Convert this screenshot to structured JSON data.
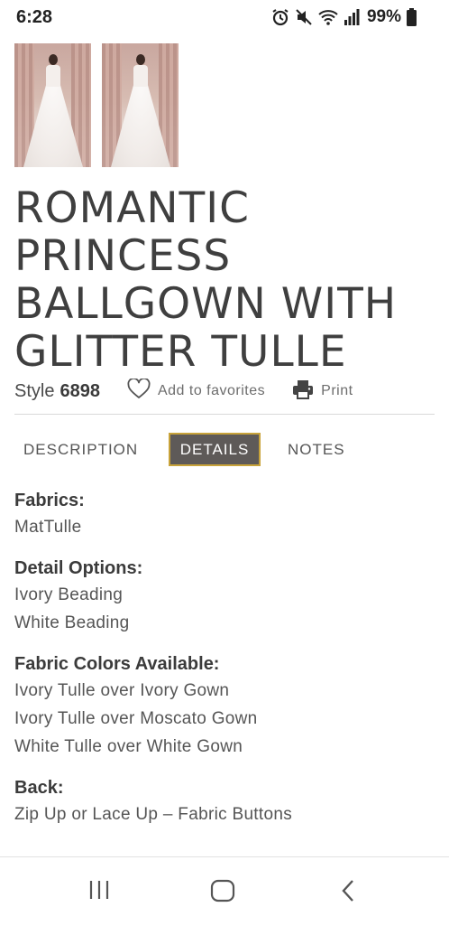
{
  "status_bar": {
    "time": "6:28",
    "battery": "99%",
    "icons": [
      "alarm-icon",
      "mute-icon",
      "wifi-icon",
      "signal-icon",
      "battery-icon"
    ]
  },
  "gallery": {
    "thumbnails": [
      "front-view-photo",
      "back-view-photo"
    ]
  },
  "product": {
    "title": "ROMANTIC PRINCESS BALLGOWN WITH GLITTER TULLE",
    "style_label": "Style",
    "style_number": "6898",
    "favorites_label": "Add to favorites",
    "print_label": "Print"
  },
  "tabs": {
    "description": "DESCRIPTION",
    "details": "DETAILS",
    "notes": "NOTES",
    "active": "details"
  },
  "details": {
    "fabrics": {
      "heading": "Fabrics:",
      "lines": [
        "MatTulle"
      ]
    },
    "detail_options": {
      "heading": "Detail Options:",
      "lines": [
        "Ivory Beading",
        "White Beading"
      ]
    },
    "fabric_colors": {
      "heading": "Fabric Colors Available:",
      "lines": [
        "Ivory Tulle over Ivory Gown",
        "Ivory Tulle over Moscato Gown",
        "White Tulle over White Gown"
      ]
    },
    "back": {
      "heading": "Back:",
      "lines": [
        "Zip Up or Lace Up – Fabric Buttons"
      ]
    }
  },
  "colors": {
    "active_tab_bg": "#5e5a58",
    "active_tab_border": "#c8a33a",
    "text": "#3a3a3a"
  },
  "nav_bar": {
    "icons": [
      "recent-apps-icon",
      "home-icon",
      "back-icon"
    ]
  }
}
